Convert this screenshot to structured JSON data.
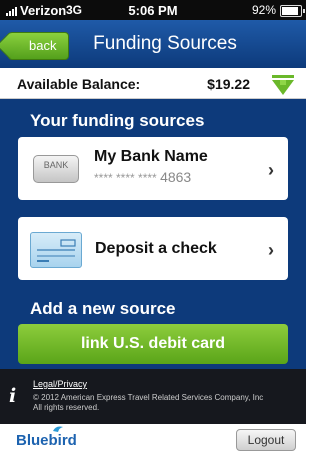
{
  "status_bar": {
    "carrier": "Verizon",
    "network": "3G",
    "time": "5:06 PM",
    "battery": "92%"
  },
  "header": {
    "back_label": "back",
    "title": "Funding Sources"
  },
  "balance": {
    "label": "Available Balance:",
    "amount": "$19.22"
  },
  "funding": {
    "section_title": "Your funding sources",
    "bank": {
      "icon_text": "BANK",
      "name": "My Bank Name",
      "masked_prefix": "**** **** ****",
      "last_four": "4863"
    },
    "check": {
      "label": "Deposit a check"
    }
  },
  "add_source": {
    "section_title": "Add a new source",
    "button_label": "link U.S. debit card"
  },
  "legal": {
    "link_label": "Legal/Privacy",
    "copyright": "© 2012 American Express Travel Related Services Company, Inc",
    "rights": "All rights reserved."
  },
  "footer": {
    "logo_text": "Bluebird",
    "logout_label": "Logout"
  },
  "colors": {
    "nav_blue": "#1f5aa8",
    "content_blue": "#0d3a7b",
    "accent_green": "#6ab82a",
    "legal_bg": "#16181e"
  }
}
